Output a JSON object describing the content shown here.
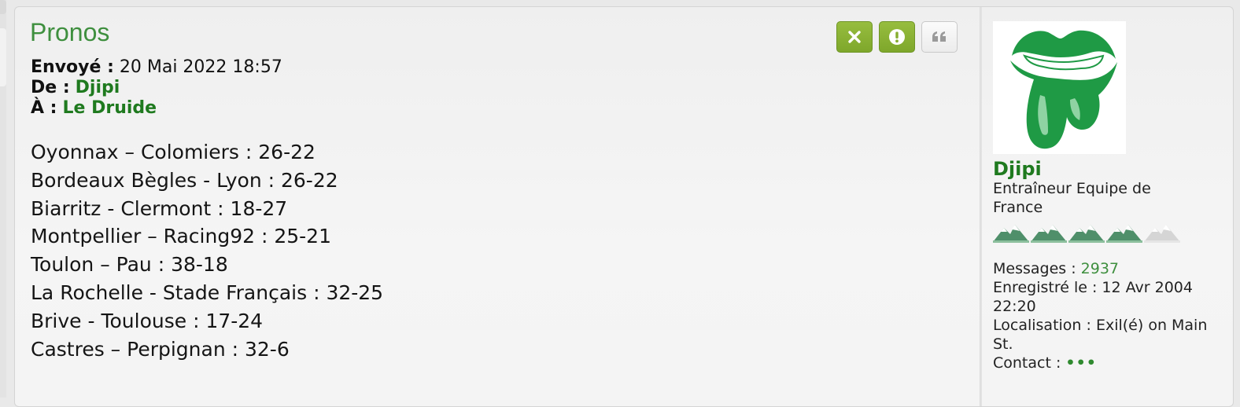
{
  "post": {
    "title": "Pronos",
    "sent_label": "Envoyé :",
    "sent_value": "20 Mai 2022 18:57",
    "from_label": "De :",
    "from_value": "Djipi",
    "to_label": "À :",
    "to_value": "Le Druide",
    "lines": [
      "Oyonnax – Colomiers : 26-22",
      "Bordeaux Bègles - Lyon : 26-22",
      "Biarritz - Clermont : 18-27",
      "Montpellier – Racing92 : 25-21",
      "Toulon – Pau : 38-18",
      "La Rochelle - Stade Français : 32-25",
      "Brive - Toulouse : 17-24",
      "Castres – Perpignan : 32-6"
    ]
  },
  "actions": {
    "delete_icon": "close-icon",
    "report_icon": "exclamation-icon",
    "quote_icon": "quote-icon",
    "accent": "#8cb535"
  },
  "profile": {
    "username": "Djipi",
    "rank": "Entraîneur Equipe de France",
    "rank_level": 4,
    "rank_max": 5,
    "messages_label": "Messages :",
    "messages_value": "2937",
    "registered_label": "Enregistré le :",
    "registered_value": "12 Avr 2004 22:20",
    "location_label": "Localisation :",
    "location_value": "Exil(é) on Main St.",
    "contact_label": "Contact :",
    "contact_value": "•••"
  },
  "colors": {
    "title_green": "#3e8f3e",
    "link_green": "#1f7a1f"
  }
}
